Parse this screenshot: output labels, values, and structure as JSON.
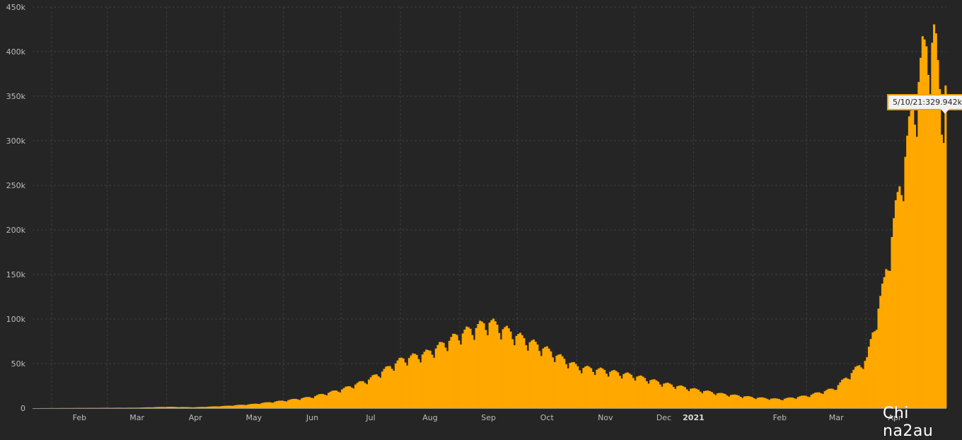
{
  "chart_data": {
    "type": "bar",
    "title": "",
    "xlabel": "",
    "ylabel": "",
    "ylim": [
      0,
      450000
    ],
    "y_ticks": [
      0,
      50000,
      100000,
      150000,
      200000,
      250000,
      300000,
      350000,
      400000,
      450000
    ],
    "y_tick_labels": [
      "0",
      "50k",
      "100k",
      "150k",
      "200k",
      "250k",
      "300k",
      "350k",
      "400k",
      "450k"
    ],
    "x_range": [
      "2020-01-22",
      "2021-05-12"
    ],
    "x_tick_labels": [
      {
        "date": "2020-02-01",
        "label": "Feb",
        "bold": false
      },
      {
        "date": "2020-03-01",
        "label": "Mar",
        "bold": false
      },
      {
        "date": "2020-04-01",
        "label": "Apr",
        "bold": false
      },
      {
        "date": "2020-05-01",
        "label": "May",
        "bold": false
      },
      {
        "date": "2020-06-01",
        "label": "Jun",
        "bold": false
      },
      {
        "date": "2020-07-01",
        "label": "Jul",
        "bold": false
      },
      {
        "date": "2020-08-01",
        "label": "Aug",
        "bold": false
      },
      {
        "date": "2020-09-01",
        "label": "Sep",
        "bold": false
      },
      {
        "date": "2020-10-01",
        "label": "Oct",
        "bold": false
      },
      {
        "date": "2020-11-01",
        "label": "Nov",
        "bold": false
      },
      {
        "date": "2020-12-01",
        "label": "Dec",
        "bold": false
      },
      {
        "date": "2021-01-01",
        "label": "2021",
        "bold": true
      },
      {
        "date": "2021-02-01",
        "label": "Feb",
        "bold": false
      },
      {
        "date": "2021-03-01",
        "label": "Mar",
        "bold": false
      },
      {
        "date": "2021-04-01",
        "label": "Apr",
        "bold": false
      }
    ],
    "grid": true,
    "bar_color": "#ffa800",
    "daily_series_keypoints": [
      {
        "date": "2020-01-22",
        "value": 0
      },
      {
        "date": "2020-03-15",
        "value": 500
      },
      {
        "date": "2020-04-01",
        "value": 1500
      },
      {
        "date": "2020-04-15",
        "value": 1000
      },
      {
        "date": "2020-05-01",
        "value": 2500
      },
      {
        "date": "2020-05-15",
        "value": 4500
      },
      {
        "date": "2020-06-01",
        "value": 8500
      },
      {
        "date": "2020-06-15",
        "value": 12500
      },
      {
        "date": "2020-07-01",
        "value": 21000
      },
      {
        "date": "2020-07-15",
        "value": 32000
      },
      {
        "date": "2020-08-01",
        "value": 54000
      },
      {
        "date": "2020-08-15",
        "value": 62000
      },
      {
        "date": "2020-09-01",
        "value": 83000
      },
      {
        "date": "2020-09-16",
        "value": 96000
      },
      {
        "date": "2020-10-01",
        "value": 80000
      },
      {
        "date": "2020-10-15",
        "value": 66000
      },
      {
        "date": "2020-11-01",
        "value": 46000
      },
      {
        "date": "2020-11-15",
        "value": 42000
      },
      {
        "date": "2020-12-01",
        "value": 36000
      },
      {
        "date": "2020-12-15",
        "value": 28000
      },
      {
        "date": "2021-01-01",
        "value": 21000
      },
      {
        "date": "2021-01-15",
        "value": 16000
      },
      {
        "date": "2021-02-01",
        "value": 12000
      },
      {
        "date": "2021-02-15",
        "value": 10000
      },
      {
        "date": "2021-03-01",
        "value": 14000
      },
      {
        "date": "2021-03-15",
        "value": 22000
      },
      {
        "date": "2021-04-01",
        "value": 55000
      },
      {
        "date": "2021-04-10",
        "value": 140000
      },
      {
        "date": "2021-04-20",
        "value": 270000
      },
      {
        "date": "2021-04-30",
        "value": 390000
      },
      {
        "date": "2021-05-06",
        "value": 414000
      },
      {
        "date": "2021-05-10",
        "value": 329942
      },
      {
        "date": "2021-05-12",
        "value": 362000
      }
    ],
    "tooltip": {
      "date": "5/10/21",
      "value": "329.942k"
    }
  },
  "tooltip_text": "5/10/21:329.942k",
  "watermark": "Chi na2au"
}
